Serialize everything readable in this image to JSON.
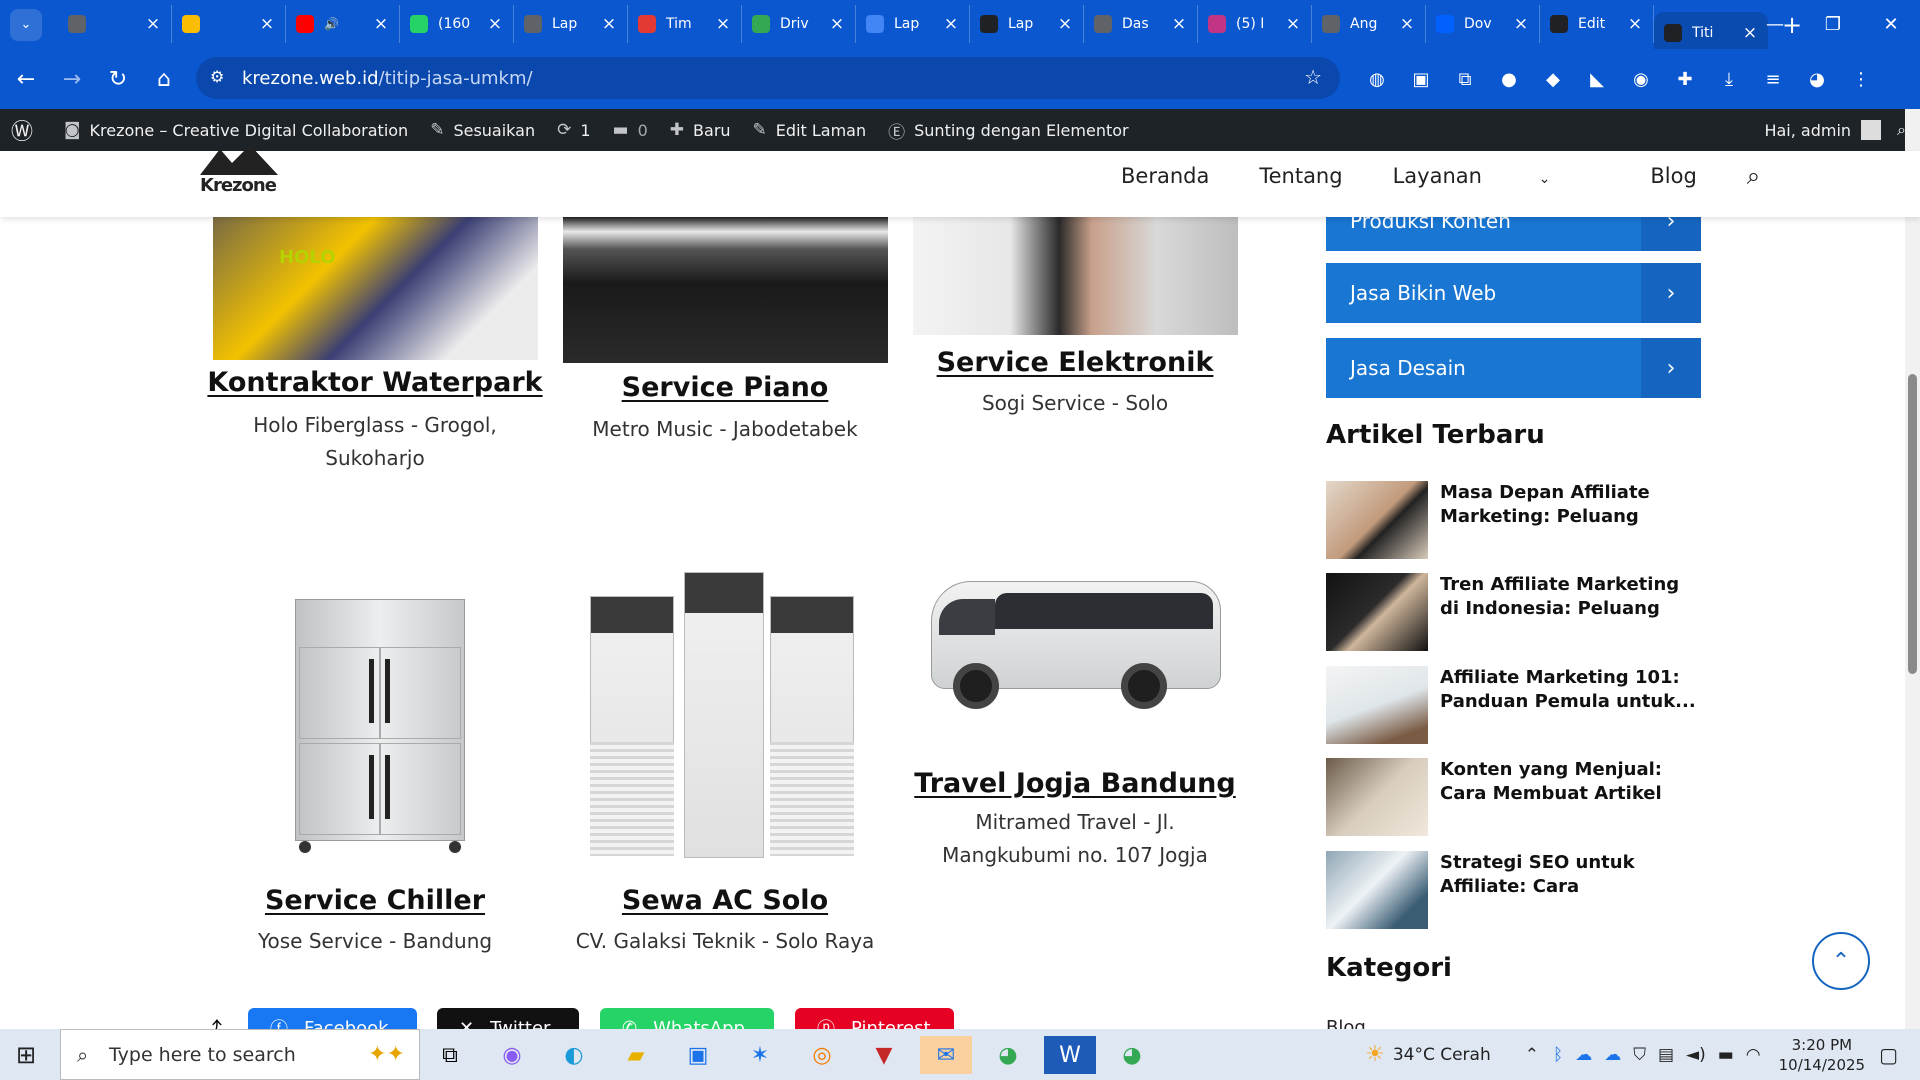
{
  "browser": {
    "tabs": [
      {
        "label": "",
        "icon": "globe-icon",
        "color": "#5f6368"
      },
      {
        "label": "",
        "icon": "google-meet-icon",
        "color": "#fbbc04"
      },
      {
        "label": "",
        "icon": "youtube-icon",
        "color": "#ff0000",
        "audio": true
      },
      {
        "label": "(160",
        "icon": "whatsapp-icon",
        "color": "#25d366"
      },
      {
        "label": "Lap",
        "icon": "globe-icon",
        "color": "#5f6368"
      },
      {
        "label": "Tim",
        "icon": "timeline-icon",
        "color": "#e53935"
      },
      {
        "label": "Driv",
        "icon": "google-drive-icon",
        "color": "#34a853"
      },
      {
        "label": "Lap",
        "icon": "google-docs-icon",
        "color": "#4285f4"
      },
      {
        "label": "Lap",
        "icon": "chatgpt-icon",
        "color": "#202124"
      },
      {
        "label": "Das",
        "icon": "globe-icon",
        "color": "#5f6368"
      },
      {
        "label": "(5) I",
        "icon": "instagram-icon",
        "color": "#c13584"
      },
      {
        "label": "Ang",
        "icon": "globe-icon",
        "color": "#5f6368"
      },
      {
        "label": "Dov",
        "icon": "dropbox-icon",
        "color": "#0061ff"
      },
      {
        "label": "Edit",
        "icon": "edit-icon",
        "color": "#202124"
      },
      {
        "label": "Titi",
        "icon": "edit-icon",
        "color": "#202124",
        "active": true
      }
    ],
    "url_domain": "krezone.web.id",
    "url_path": "/titip-jasa-umkm/"
  },
  "wp_admin_bar": {
    "site_name": "Krezone – Creative Digital Collaboration",
    "customize": "Sesuaikan",
    "updates": "1",
    "comments": "0",
    "new": "Baru",
    "edit_page": "Edit Laman",
    "elementor": "Sunting dengan Elementor",
    "greeting": "Hai, admin"
  },
  "site": {
    "logo_text": "Krezone",
    "nav": [
      "Beranda",
      "Tentang",
      "Layanan",
      "Blog"
    ]
  },
  "services": [
    {
      "title": "Kontraktor Waterpark",
      "subtitle_line1": "Holo Fiberglass - Grogol,",
      "subtitle_line2": "Sukoharjo",
      "image": "waterpark-photo"
    },
    {
      "title": "Service Piano",
      "subtitle_line1": "Metro Music - Jabodetabek",
      "subtitle_line2": "",
      "image": "piano-photo"
    },
    {
      "title": "Service Elektronik",
      "subtitle_line1": "Sogi Service - Solo",
      "subtitle_line2": "",
      "image": "washing-machine-photo"
    },
    {
      "title": "Service Chiller",
      "subtitle_line1": "Yose Service - Bandung",
      "subtitle_line2": "",
      "image": "chiller-photo"
    },
    {
      "title": "Sewa AC Solo",
      "subtitle_line1": "CV. Galaksi Teknik - Solo Raya",
      "subtitle_line2": "",
      "image": "ac-photo"
    },
    {
      "title": "Travel Jogja Bandung",
      "subtitle_line1": "Mitramed Travel - Jl.",
      "subtitle_line2": "Mangkubumi no. 107 Jogja",
      "image": "minibus-photo"
    }
  ],
  "sidebar": {
    "buttons": [
      "Produksi Konten",
      "Jasa Bikin Web",
      "Jasa Desain"
    ],
    "recent_title": "Artikel Terbaru",
    "articles": [
      {
        "title": "Masa Depan Affiliate Marketing: Peluang Baru..."
      },
      {
        "title": "Tren Affiliate Marketing di Indonesia: Peluang dan..."
      },
      {
        "title": "Affiliate Marketing 101: Panduan Pemula untuk..."
      },
      {
        "title": "Konten yang Menjual: Cara Membuat Artikel da..."
      },
      {
        "title": "Strategi SEO untuk Affiliate: Cara Membuat..."
      }
    ],
    "category_title": "Kategori",
    "first_category": "Blog"
  },
  "share": [
    {
      "label": "Facebook",
      "color": "#1877f2"
    },
    {
      "label": "Twitter",
      "color": "#111111"
    },
    {
      "label": "WhatsApp",
      "color": "#25d366"
    },
    {
      "label": "Pinterest",
      "color": "#e60023"
    }
  ],
  "taskbar": {
    "search_placeholder": "Type here to search",
    "weather": "34°C  Cerah",
    "time": "3:20 PM",
    "date": "10/14/2025"
  }
}
